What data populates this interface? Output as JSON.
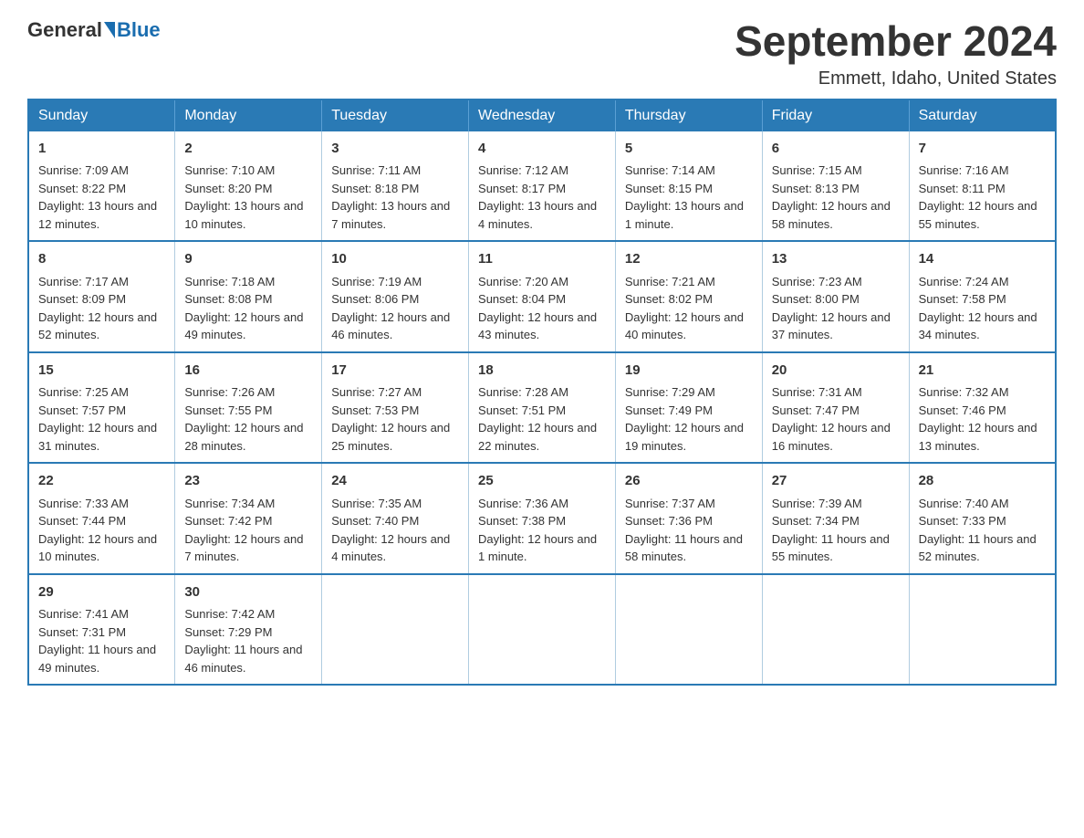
{
  "header": {
    "logo_general": "General",
    "logo_blue": "Blue",
    "month_title": "September 2024",
    "location": "Emmett, Idaho, United States"
  },
  "days_of_week": [
    "Sunday",
    "Monday",
    "Tuesday",
    "Wednesday",
    "Thursday",
    "Friday",
    "Saturday"
  ],
  "weeks": [
    [
      {
        "day": "1",
        "sunrise": "7:09 AM",
        "sunset": "8:22 PM",
        "daylight": "13 hours and 12 minutes."
      },
      {
        "day": "2",
        "sunrise": "7:10 AM",
        "sunset": "8:20 PM",
        "daylight": "13 hours and 10 minutes."
      },
      {
        "day": "3",
        "sunrise": "7:11 AM",
        "sunset": "8:18 PM",
        "daylight": "13 hours and 7 minutes."
      },
      {
        "day": "4",
        "sunrise": "7:12 AM",
        "sunset": "8:17 PM",
        "daylight": "13 hours and 4 minutes."
      },
      {
        "day": "5",
        "sunrise": "7:14 AM",
        "sunset": "8:15 PM",
        "daylight": "13 hours and 1 minute."
      },
      {
        "day": "6",
        "sunrise": "7:15 AM",
        "sunset": "8:13 PM",
        "daylight": "12 hours and 58 minutes."
      },
      {
        "day": "7",
        "sunrise": "7:16 AM",
        "sunset": "8:11 PM",
        "daylight": "12 hours and 55 minutes."
      }
    ],
    [
      {
        "day": "8",
        "sunrise": "7:17 AM",
        "sunset": "8:09 PM",
        "daylight": "12 hours and 52 minutes."
      },
      {
        "day": "9",
        "sunrise": "7:18 AM",
        "sunset": "8:08 PM",
        "daylight": "12 hours and 49 minutes."
      },
      {
        "day": "10",
        "sunrise": "7:19 AM",
        "sunset": "8:06 PM",
        "daylight": "12 hours and 46 minutes."
      },
      {
        "day": "11",
        "sunrise": "7:20 AM",
        "sunset": "8:04 PM",
        "daylight": "12 hours and 43 minutes."
      },
      {
        "day": "12",
        "sunrise": "7:21 AM",
        "sunset": "8:02 PM",
        "daylight": "12 hours and 40 minutes."
      },
      {
        "day": "13",
        "sunrise": "7:23 AM",
        "sunset": "8:00 PM",
        "daylight": "12 hours and 37 minutes."
      },
      {
        "day": "14",
        "sunrise": "7:24 AM",
        "sunset": "7:58 PM",
        "daylight": "12 hours and 34 minutes."
      }
    ],
    [
      {
        "day": "15",
        "sunrise": "7:25 AM",
        "sunset": "7:57 PM",
        "daylight": "12 hours and 31 minutes."
      },
      {
        "day": "16",
        "sunrise": "7:26 AM",
        "sunset": "7:55 PM",
        "daylight": "12 hours and 28 minutes."
      },
      {
        "day": "17",
        "sunrise": "7:27 AM",
        "sunset": "7:53 PM",
        "daylight": "12 hours and 25 minutes."
      },
      {
        "day": "18",
        "sunrise": "7:28 AM",
        "sunset": "7:51 PM",
        "daylight": "12 hours and 22 minutes."
      },
      {
        "day": "19",
        "sunrise": "7:29 AM",
        "sunset": "7:49 PM",
        "daylight": "12 hours and 19 minutes."
      },
      {
        "day": "20",
        "sunrise": "7:31 AM",
        "sunset": "7:47 PM",
        "daylight": "12 hours and 16 minutes."
      },
      {
        "day": "21",
        "sunrise": "7:32 AM",
        "sunset": "7:46 PM",
        "daylight": "12 hours and 13 minutes."
      }
    ],
    [
      {
        "day": "22",
        "sunrise": "7:33 AM",
        "sunset": "7:44 PM",
        "daylight": "12 hours and 10 minutes."
      },
      {
        "day": "23",
        "sunrise": "7:34 AM",
        "sunset": "7:42 PM",
        "daylight": "12 hours and 7 minutes."
      },
      {
        "day": "24",
        "sunrise": "7:35 AM",
        "sunset": "7:40 PM",
        "daylight": "12 hours and 4 minutes."
      },
      {
        "day": "25",
        "sunrise": "7:36 AM",
        "sunset": "7:38 PM",
        "daylight": "12 hours and 1 minute."
      },
      {
        "day": "26",
        "sunrise": "7:37 AM",
        "sunset": "7:36 PM",
        "daylight": "11 hours and 58 minutes."
      },
      {
        "day": "27",
        "sunrise": "7:39 AM",
        "sunset": "7:34 PM",
        "daylight": "11 hours and 55 minutes."
      },
      {
        "day": "28",
        "sunrise": "7:40 AM",
        "sunset": "7:33 PM",
        "daylight": "11 hours and 52 minutes."
      }
    ],
    [
      {
        "day": "29",
        "sunrise": "7:41 AM",
        "sunset": "7:31 PM",
        "daylight": "11 hours and 49 minutes."
      },
      {
        "day": "30",
        "sunrise": "7:42 AM",
        "sunset": "7:29 PM",
        "daylight": "11 hours and 46 minutes."
      },
      null,
      null,
      null,
      null,
      null
    ]
  ]
}
